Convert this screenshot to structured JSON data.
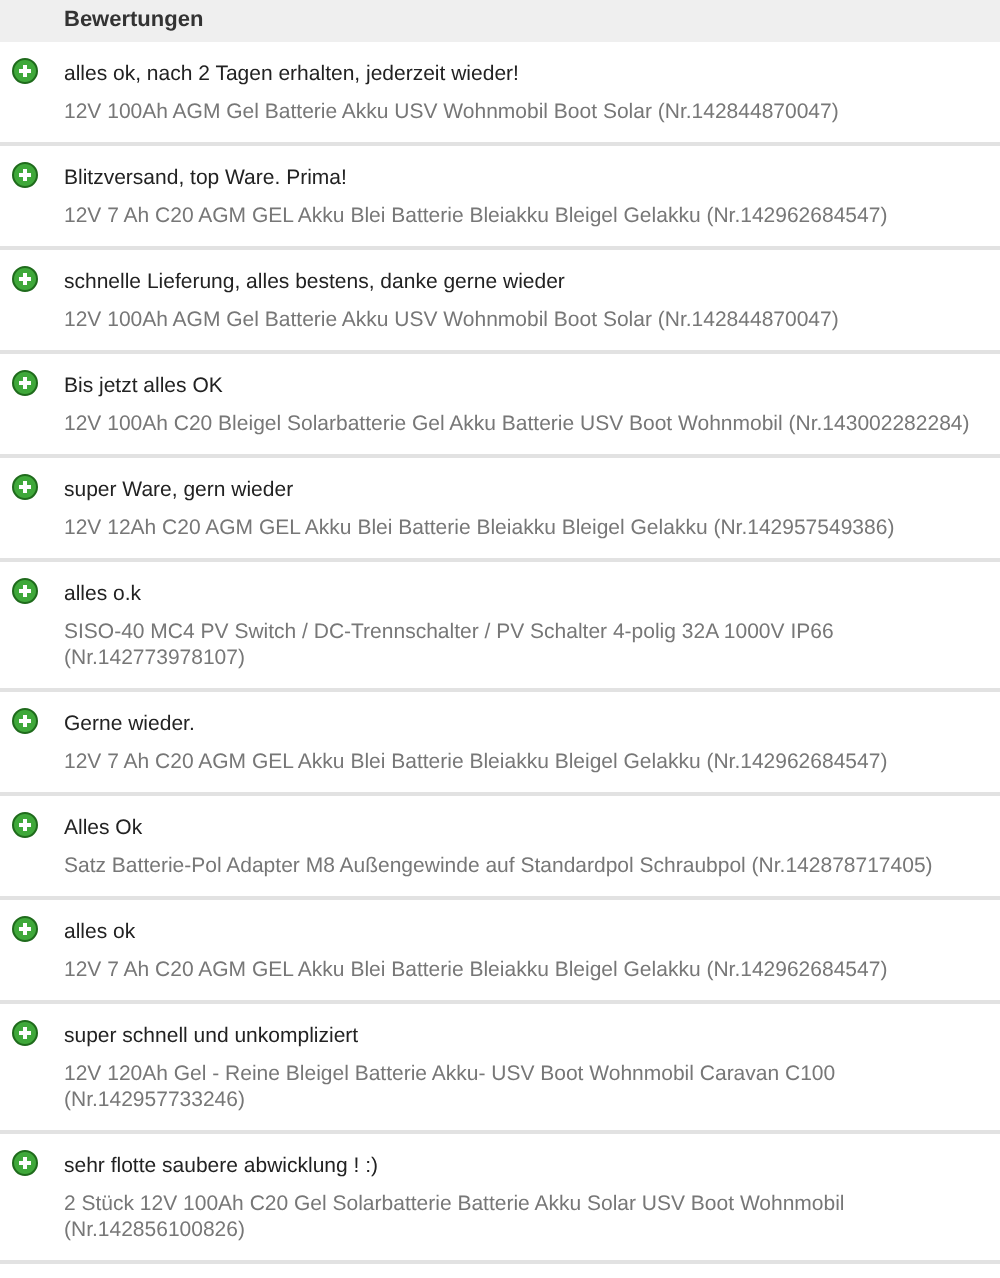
{
  "header": {
    "title": "Bewertungen"
  },
  "reviews": [
    {
      "kind": "positive",
      "comment": "alles ok, nach 2 Tagen erhalten, jederzeit wieder!",
      "item": "12V 100Ah AGM Gel Batterie Akku USV Wohnmobil Boot Solar (Nr.142844870047)"
    },
    {
      "kind": "positive",
      "comment": "Blitzversand, top Ware. Prima!",
      "item": "12V 7 Ah C20 AGM GEL Akku Blei Batterie Bleiakku Bleigel Gelakku (Nr.142962684547)"
    },
    {
      "kind": "positive",
      "comment": "schnelle Lieferung, alles bestens, danke gerne wieder",
      "item": "12V 100Ah AGM Gel Batterie Akku USV Wohnmobil Boot Solar (Nr.142844870047)"
    },
    {
      "kind": "positive",
      "comment": "Bis jetzt alles OK",
      "item": "12V 100Ah C20 Bleigel Solarbatterie Gel Akku Batterie USV Boot Wohnmobil (Nr.143002282284)"
    },
    {
      "kind": "positive",
      "comment": "super Ware, gern wieder",
      "item": "12V 12Ah C20 AGM GEL Akku Blei Batterie Bleiakku Bleigel Gelakku (Nr.142957549386)"
    },
    {
      "kind": "positive",
      "comment": "alles o.k",
      "item": "SISO-40 MC4 PV Switch / DC-Trennschalter / PV Schalter 4-polig 32A 1000V IP66 (Nr.142773978107)"
    },
    {
      "kind": "positive",
      "comment": "Gerne wieder.",
      "item": "12V 7 Ah C20 AGM GEL Akku Blei Batterie Bleiakku Bleigel Gelakku (Nr.142962684547)"
    },
    {
      "kind": "positive",
      "comment": "Alles Ok",
      "item": "Satz Batterie-Pol Adapter M8 Außengewinde auf Standardpol Schraubpol (Nr.142878717405)"
    },
    {
      "kind": "positive",
      "comment": "alles ok",
      "item": "12V 7 Ah C20 AGM GEL Akku Blei Batterie Bleiakku Bleigel Gelakku (Nr.142962684547)"
    },
    {
      "kind": "positive",
      "comment": "super schnell und unkompliziert",
      "item": "12V 120Ah Gel - Reine Bleigel Batterie Akku- USV Boot Wohnmobil Caravan C100 (Nr.142957733246)"
    },
    {
      "kind": "positive",
      "comment": "sehr flotte saubere abwicklung ! :)",
      "item": "2 Stück 12V 100Ah C20 Gel Solarbatterie Batterie Akku Solar USV Boot Wohnmobil (Nr.142856100826)"
    }
  ]
}
